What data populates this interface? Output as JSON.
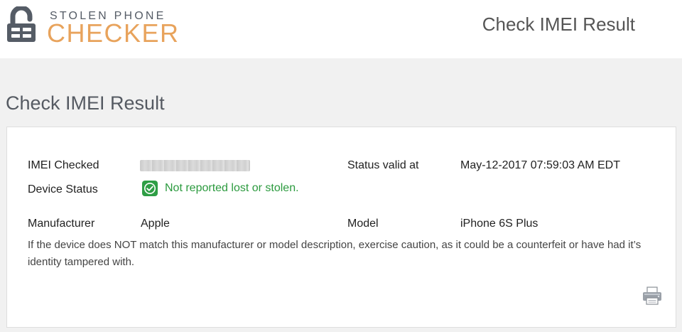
{
  "header": {
    "logo_top": "STOLEN PHONE",
    "logo_bottom": "CHECKER",
    "title": "Check IMEI Result"
  },
  "main": {
    "page_title": "Check IMEI Result"
  },
  "result": {
    "imei_label": "IMEI Checked",
    "status_valid_label": "Status valid at",
    "status_valid_value": "May-12-2017 07:59:03 AM EDT",
    "device_status_label": "Device Status",
    "device_status_value": "Not reported lost or stolen.",
    "manufacturer_label": "Manufacturer",
    "manufacturer_value": "Apple",
    "model_label": "Model",
    "model_value": "iPhone 6S Plus",
    "note": "If the device does NOT match this manufacturer or model description, exercise caution, as it could be a counterfeit or have had it’s identity tampered with."
  },
  "colors": {
    "accent": "#e8a35c",
    "status_ok": "#2e9e45",
    "page_bg": "#f1f1f1"
  },
  "icons": {
    "logo": "padlock-phone-icon",
    "status": "checkmark-circle-icon",
    "print": "printer-icon"
  }
}
